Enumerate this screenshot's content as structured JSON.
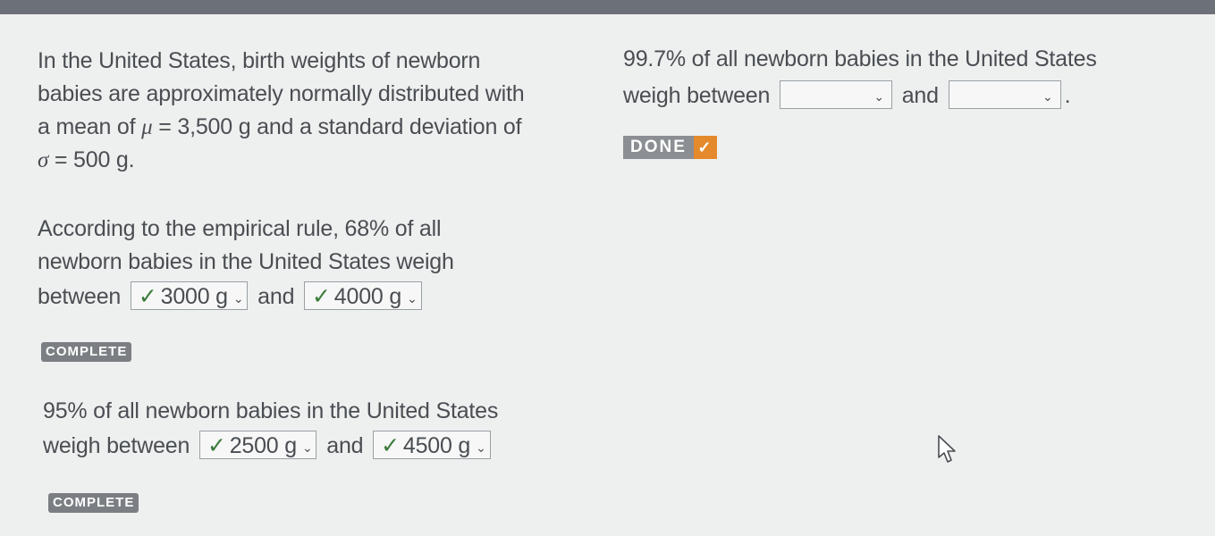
{
  "intro": {
    "line1": "In the United States, birth weights of newborn",
    "line2": "babies are approximately normally distributed with",
    "line3_pre": "a mean of ",
    "mu": "μ",
    "line3_post": " = 3,500 g and a standard deviation of",
    "sigma": "σ",
    "line4_post": " = 500 g."
  },
  "q68": {
    "line1": "According to the empirical rule, 68% of all",
    "line2": "newborn babies in the United States weigh",
    "between": "between",
    "and": "and",
    "answer1": "3000 g",
    "answer2": "4000 g",
    "status": "COMPLETE"
  },
  "q95": {
    "line1": "95% of all newborn babies in the United States",
    "between": "weigh between",
    "and": "and",
    "answer1": "2500 g",
    "answer2": "4500 g",
    "status": "COMPLETE"
  },
  "q997": {
    "line1": "99.7% of all newborn babies in the United States",
    "between": "weigh between",
    "and": "and",
    "period": ".",
    "done_label": "DONE"
  },
  "icons": {
    "check": "✓",
    "caret": "⌄"
  },
  "colors": {
    "badge": "#7b7e82",
    "done_accent": "#e58a2c"
  }
}
